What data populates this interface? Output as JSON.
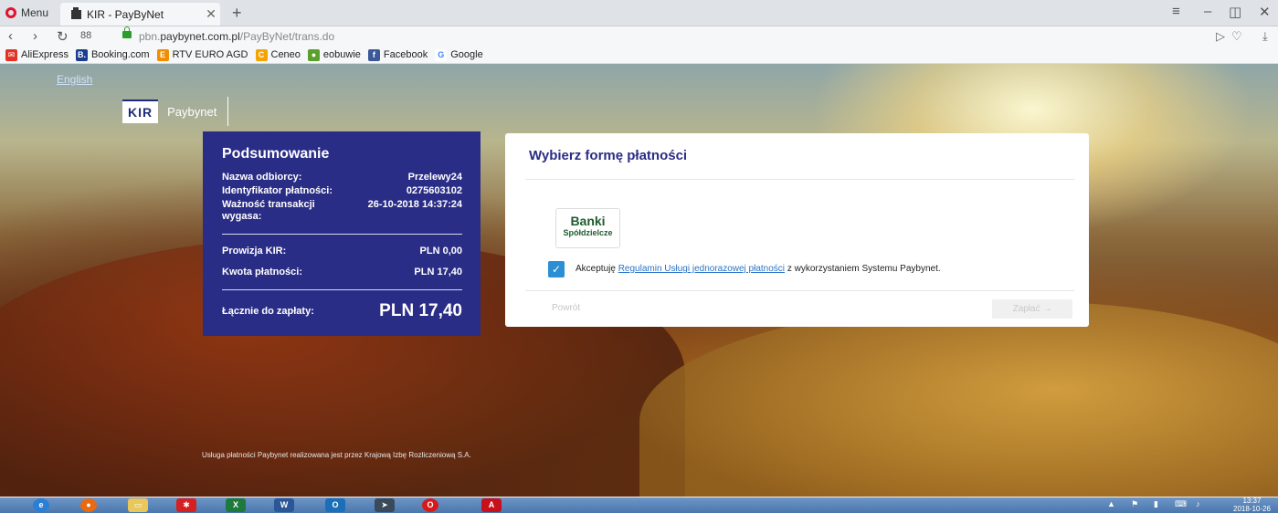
{
  "browser": {
    "menu_label": "Menu",
    "tab_title": "KIR - PayByNet",
    "tab_close": "✕",
    "new_tab": "+",
    "url_prefix": "pbn.",
    "url_host": "paybynet.com.pl",
    "url_path": "/PayByNet/trans.do",
    "speed_dial": "88"
  },
  "bookmarks": [
    {
      "label": "AliExpress",
      "icon": "aliexpress-icon",
      "color": "#e43225",
      "glyph": "✉"
    },
    {
      "label": "Booking.com",
      "icon": "booking-icon",
      "color": "#1b3d8f",
      "glyph": "B."
    },
    {
      "label": "RTV EURO AGD",
      "icon": "rtv-icon",
      "color": "#f28c00",
      "glyph": "E"
    },
    {
      "label": "Ceneo",
      "icon": "ceneo-icon",
      "color": "#f5a300",
      "glyph": "C"
    },
    {
      "label": "eobuwie",
      "icon": "eobuwie-icon",
      "color": "#5aa02c",
      "glyph": "●"
    },
    {
      "label": "Facebook",
      "icon": "facebook-icon",
      "color": "#3b5998",
      "glyph": "f"
    },
    {
      "label": "Google",
      "icon": "google-icon",
      "color": "#ffffff",
      "glyph": "G"
    }
  ],
  "page": {
    "language_link": "English",
    "logo_kir": "KIR",
    "logo_paybynet": "Paybynet",
    "footer_note": "Usługa płatności Paybynet realizowana jest przez Krajową Izbę Rozliczeniową S.A."
  },
  "summary": {
    "title": "Podsumowanie",
    "recipient_label": "Nazwa odbiorcy:",
    "recipient_value": "Przelewy24",
    "payment_id_label": "Identyfikator płatności:",
    "payment_id_value": "0275603102",
    "expiry_label": "Ważność transakcji wygasa:",
    "expiry_value": "26-10-2018 14:37:24",
    "commission_label": "Prowizja KIR:",
    "commission_value": "PLN 0,00",
    "amount_label": "Kwota płatności:",
    "amount_value": "PLN 17,40",
    "total_label": "Łącznie do zapłaty:",
    "total_value": "PLN 17,40"
  },
  "payment": {
    "title": "Wybierz formę płatności",
    "bank_name_line1": "Banki",
    "bank_name_line2": "Spółdzielcze",
    "terms_prefix": "Akceptuję",
    "terms_link": "Regulamin Usługi jednorazowej płatności",
    "terms_suffix": "z wykorzystaniem Systemu Paybynet.",
    "back_label": "Powrót",
    "pay_label": "Zapłać →"
  },
  "taskbar": {
    "clock_time": "13:37",
    "clock_date": "2018-10-26"
  }
}
